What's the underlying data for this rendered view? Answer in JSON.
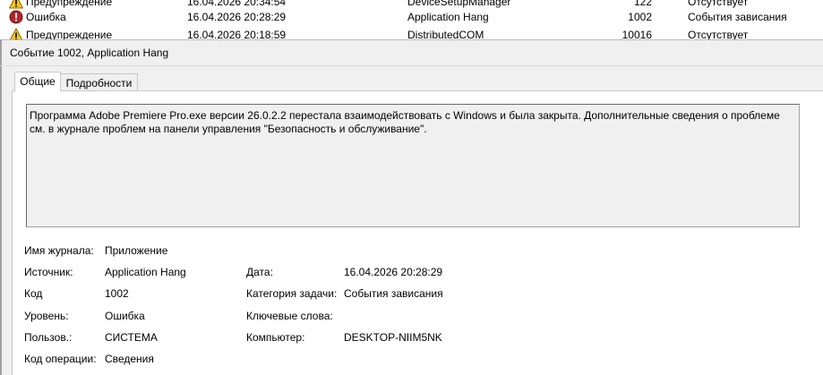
{
  "event_list": {
    "rows": [
      {
        "level": "Предупреждение",
        "level_icon": "warning-icon",
        "date": "16.04.2026 20:34:54",
        "source": "DeviceSetupManager",
        "id": "122",
        "category": "Отсутствует"
      },
      {
        "level": "Ошибка",
        "level_icon": "error-icon",
        "date": "16.04.2026 20:28:29",
        "source": "Application Hang",
        "id": "1002",
        "category": "События зависания"
      },
      {
        "level": "Предупреждение",
        "level_icon": "warning-icon",
        "date": "16.04.2026 20:18:59",
        "source": "DistributedCOM",
        "id": "10016",
        "category": "Отсутствует"
      }
    ]
  },
  "details": {
    "title": "Событие 1002, Application Hang",
    "tabs": {
      "general": "Общие",
      "details": "Подробности"
    },
    "description": "Программа Adobe Premiere Pro.exe версии 26.0.2.2 перестала взаимодействовать с Windows и была закрыта. Дополнительные сведения о проблеме см. в журнале проблем на панели управления \"Безопасность и обслуживание\".",
    "fields": {
      "log_name": {
        "label": "Имя журнала:",
        "value": "Приложение"
      },
      "source": {
        "label": "Источник:",
        "value": "Application Hang"
      },
      "date": {
        "label": "Дата:",
        "value": "16.04.2026 20:28:29"
      },
      "event_id": {
        "label": "Код",
        "value": "1002"
      },
      "task_category": {
        "label": "Категория задачи:",
        "value": "События зависания"
      },
      "level": {
        "label": "Уровень:",
        "value": "Ошибка"
      },
      "keywords": {
        "label": "Ключевые слова:",
        "value": ""
      },
      "user": {
        "label": "Пользов.:",
        "value": "СИСТЕМА"
      },
      "computer": {
        "label": "Компьютер:",
        "value": "DESKTOP-NIIM5NK"
      },
      "opcode": {
        "label": "Код операции:",
        "value": "Сведения"
      }
    }
  },
  "colors": {
    "warning": "#f5c518",
    "error": "#b4242a",
    "panel_bg": "#f0f0f0"
  }
}
